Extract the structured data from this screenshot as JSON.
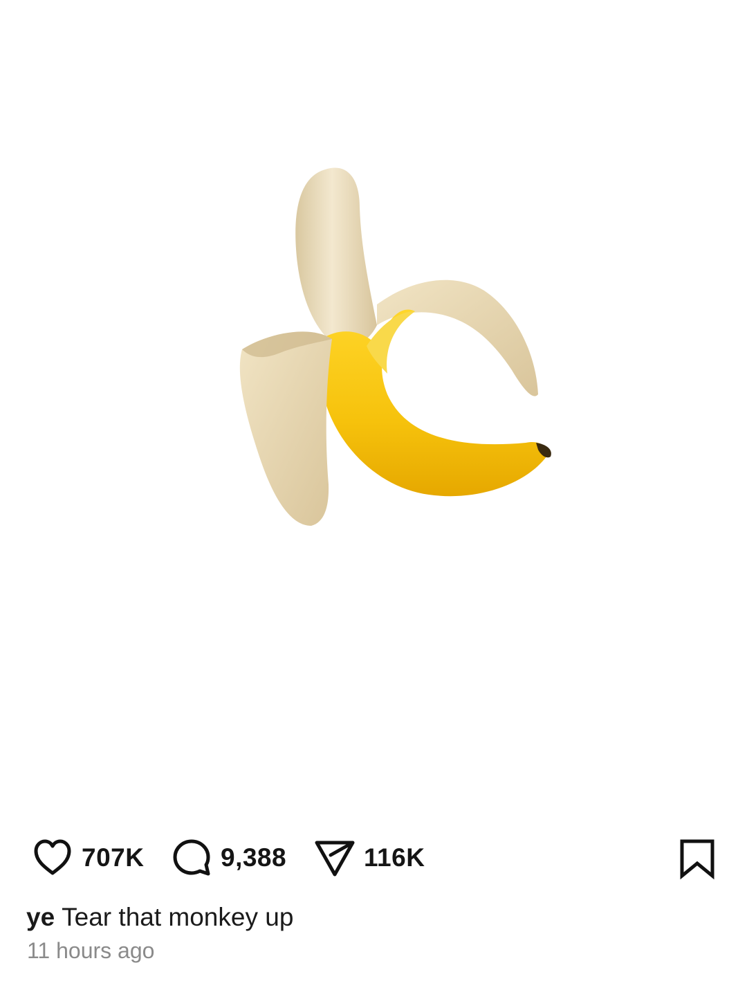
{
  "post": {
    "image_subject": "banana-emoji",
    "colors": {
      "peel": "#f5cf10",
      "peel_shadow": "#e0a800",
      "flesh": "#efe3c6",
      "flesh_shadow": "#d6c39b",
      "tip": "#3a2a10"
    }
  },
  "actions": {
    "likes": "707K",
    "comments": "9,388",
    "shares": "116K"
  },
  "caption": {
    "username": "ye",
    "text": "Tear that monkey up"
  },
  "timestamp": "11 hours ago"
}
